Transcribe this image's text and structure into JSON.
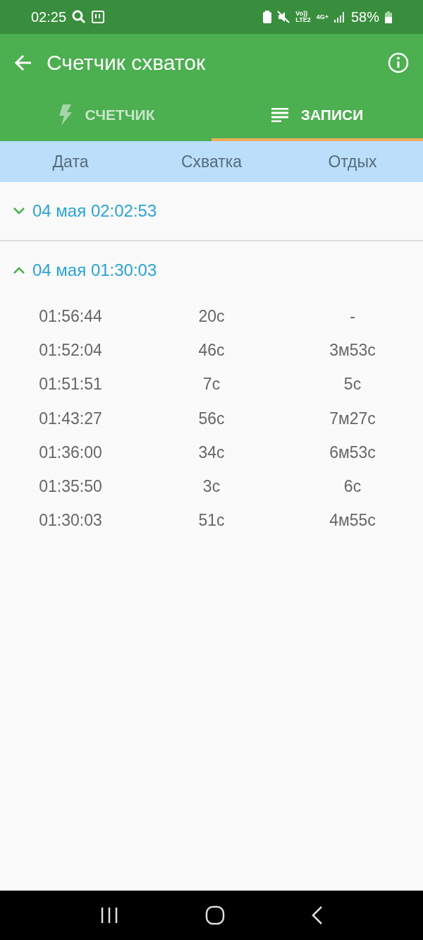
{
  "status_bar": {
    "time": "02:25",
    "volte": "Vo))",
    "lte": "LTE2",
    "network": "4G+",
    "battery": "58%"
  },
  "app_bar": {
    "title": "Счетчик схваток"
  },
  "tabs": [
    {
      "label": "СЧЕТЧИК",
      "kind": "bolt",
      "selected": false
    },
    {
      "label": "ЗАПИСИ",
      "kind": "list",
      "selected": true
    }
  ],
  "columns": [
    "Дата",
    "Схватка",
    "Отдых"
  ],
  "groups": [
    {
      "date": "04 мая 02:02:53",
      "expanded": false
    },
    {
      "date": "04 мая 01:30:03",
      "expanded": true,
      "rows": [
        {
          "time": "01:56:44",
          "contraction": "20с",
          "rest": "-"
        },
        {
          "time": "01:52:04",
          "contraction": "46с",
          "rest": "3м53с"
        },
        {
          "time": "01:51:51",
          "contraction": "7с",
          "rest": "5с"
        },
        {
          "time": "01:43:27",
          "contraction": "56с",
          "rest": "7м27с"
        },
        {
          "time": "01:36:00",
          "contraction": "34с",
          "rest": "6м53с"
        },
        {
          "time": "01:35:50",
          "contraction": "3с",
          "rest": "6с"
        },
        {
          "time": "01:30:03",
          "contraction": "51с",
          "rest": "4м55с"
        }
      ]
    }
  ]
}
